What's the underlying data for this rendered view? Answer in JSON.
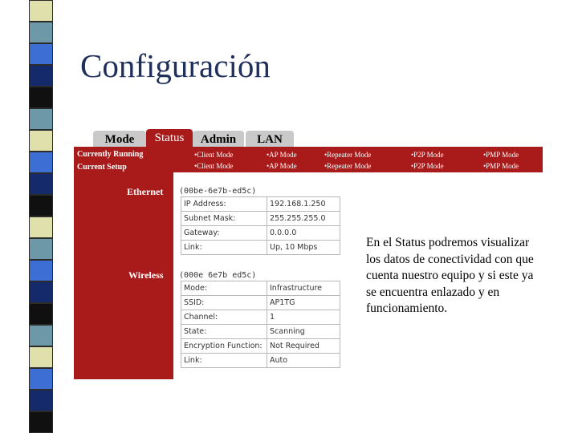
{
  "slide": {
    "title": "Configuración",
    "note": "En el Status podremos visualizar los datos de conectividad con que cuenta nuestro equipo y si este ya se encuentra enlazado y en funcionamiento."
  },
  "tabs": [
    "Mode",
    "Status",
    "Admin",
    "LAN"
  ],
  "active_tab": "Status",
  "mode_bar": {
    "currently_running_label": "Currently Running",
    "current_setup_label": "Current Setup",
    "options_row1": [
      "•Client Mode",
      "•AP Mode",
      "•Repeater Mode",
      "•P2P Mode",
      "•PMP Mode"
    ],
    "options_row2": [
      "•Client Mode",
      "•AP Mode",
      "•Repeater Mode",
      "•P2P Mode",
      "•PMP Mode"
    ]
  },
  "ethernet": {
    "label": "Ethernet",
    "mac": "(00be-6e7b-ed5c)",
    "rows": [
      {
        "label": "IP Address:",
        "value": "192.168.1.250"
      },
      {
        "label": "Subnet Mask:",
        "value": "255.255.255.0"
      },
      {
        "label": "Gateway:",
        "value": "0.0.0.0"
      },
      {
        "label": "Link:",
        "value": "Up, 10 Mbps"
      }
    ]
  },
  "wireless": {
    "label": "Wireless",
    "mac": "(000e 6e7b ed5c)",
    "rows": [
      {
        "label": "Mode:",
        "value": "Infrastructure"
      },
      {
        "label": "SSID:",
        "value": "AP1TG"
      },
      {
        "label": "Channel:",
        "value": "1"
      },
      {
        "label": "State:",
        "value": "Scanning"
      },
      {
        "label": "Encryption Function:",
        "value": "Not Required"
      },
      {
        "label": "Link:",
        "value": "Auto"
      }
    ]
  },
  "colors": {
    "title": "#1f2f5a",
    "router_red": "#a91b1b",
    "tab_gray": "#c9c9c9",
    "strip_light": "#e0e0ad",
    "strip_teal": "#6c98a8",
    "strip_blue": "#3d6ed4",
    "strip_navy": "#152a6a",
    "strip_black": "#101010"
  }
}
